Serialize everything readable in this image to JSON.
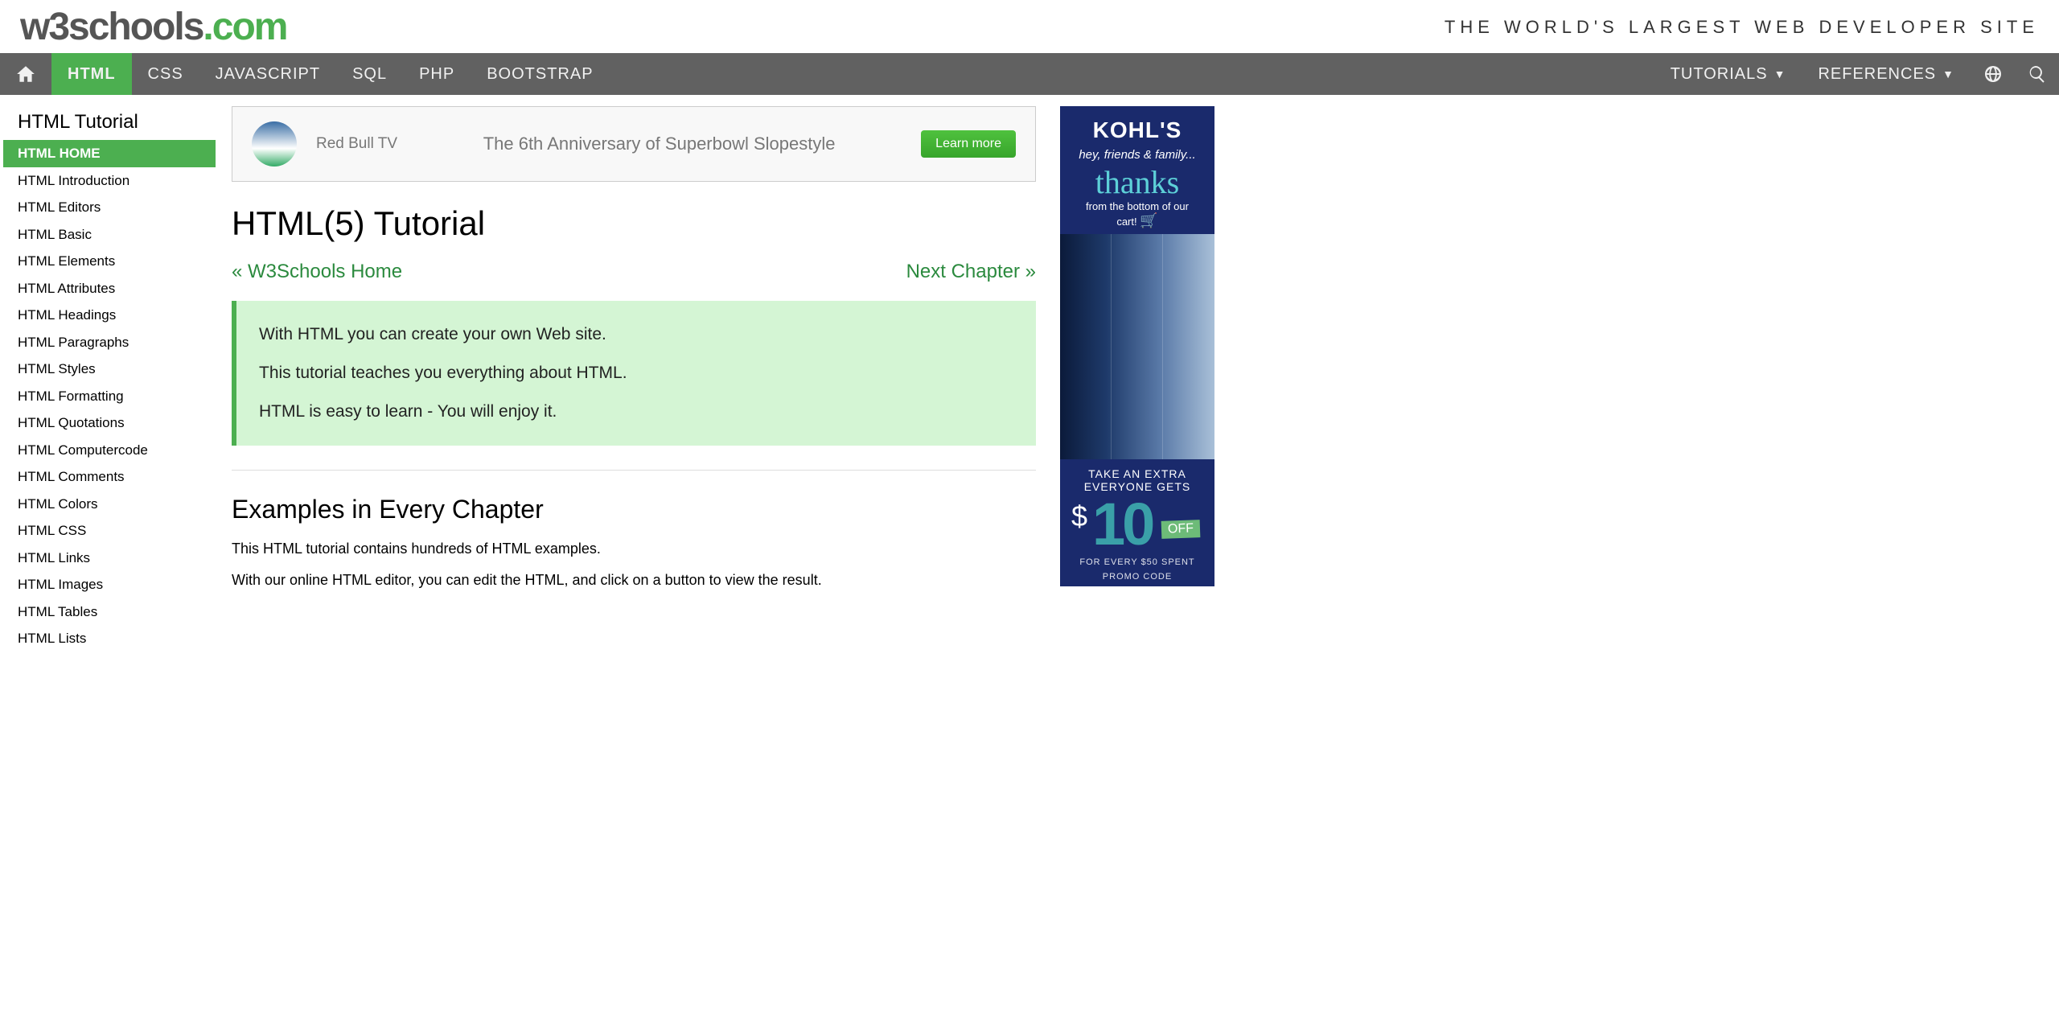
{
  "header": {
    "logo_part1": "w3schools",
    "logo_part2": ".com",
    "tagline": "THE WORLD'S LARGEST WEB DEVELOPER SITE"
  },
  "topnav": {
    "items": [
      {
        "label": "HTML",
        "active": true
      },
      {
        "label": "CSS"
      },
      {
        "label": "JAVASCRIPT"
      },
      {
        "label": "SQL"
      },
      {
        "label": "PHP"
      },
      {
        "label": "BOOTSTRAP"
      }
    ],
    "tutorials": "TUTORIALS",
    "references": "REFERENCES"
  },
  "sidebar": {
    "heading": "HTML Tutorial",
    "items": [
      "HTML HOME",
      "HTML Introduction",
      "HTML Editors",
      "HTML Basic",
      "HTML Elements",
      "HTML Attributes",
      "HTML Headings",
      "HTML Paragraphs",
      "HTML Styles",
      "HTML Formatting",
      "HTML Quotations",
      "HTML Computercode",
      "HTML Comments",
      "HTML Colors",
      "HTML CSS",
      "HTML Links",
      "HTML Images",
      "HTML Tables",
      "HTML Lists"
    ],
    "active_index": 0
  },
  "ad_top": {
    "brand": "Red Bull TV",
    "title": "The 6th Anniversary of Superbowl Slopestyle",
    "button": "Learn more"
  },
  "main": {
    "title": "HTML(5) Tutorial",
    "prev": "«  W3Schools Home",
    "next": "Next Chapter  »",
    "intro": [
      "With HTML you can create your own Web site.",
      "This tutorial teaches you everything about HTML.",
      "HTML is easy to learn - You will enjoy it."
    ],
    "section_title": "Examples in Every Chapter",
    "body1": "This HTML tutorial contains hundreds of HTML examples.",
    "body2": "With our online HTML editor, you can edit the HTML, and click on a button to view the result."
  },
  "ad_side": {
    "logo": "KOHL'S",
    "sub": "hey, friends & family...",
    "thanks": "thanks",
    "line1": "from the bottom of our cart!",
    "take": "TAKE AN EXTRA EVERYONE GETS",
    "dollar": "$",
    "ten": "10",
    "off": "OFF",
    "promo1": "FOR EVERY $50 SPENT",
    "promo2": "PROMO CODE"
  }
}
